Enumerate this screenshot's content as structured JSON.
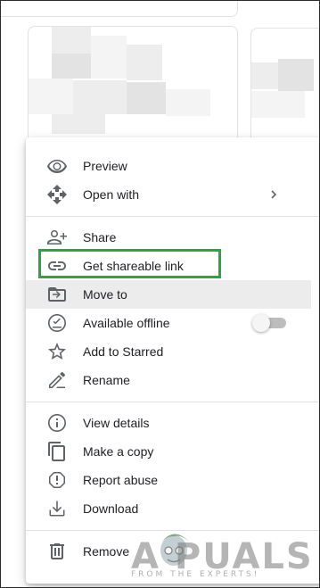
{
  "menu": {
    "groups": [
      [
        {
          "label": "Preview",
          "icon": "eye-icon"
        },
        {
          "label": "Open with",
          "icon": "move-arrows-icon",
          "submenu": true
        }
      ],
      [
        {
          "label": "Share",
          "icon": "person-add-icon"
        },
        {
          "label": "Get shareable link",
          "icon": "link-icon",
          "outlined": true
        },
        {
          "label": "Move to",
          "icon": "folder-move-icon",
          "hovered": true
        },
        {
          "label": "Available offline",
          "icon": "offline-check-icon",
          "toggle": false
        },
        {
          "label": "Add to Starred",
          "icon": "star-outline-icon"
        },
        {
          "label": "Rename",
          "icon": "pencil-icon"
        }
      ],
      [
        {
          "label": "View details",
          "icon": "info-icon"
        },
        {
          "label": "Make a copy",
          "icon": "copy-icon"
        },
        {
          "label": "Report abuse",
          "icon": "report-icon"
        },
        {
          "label": "Download",
          "icon": "download-icon"
        }
      ],
      [
        {
          "label": "Remove",
          "icon": "trash-icon"
        }
      ]
    ]
  },
  "annotation": {
    "color": "#2aa640"
  },
  "watermark": {
    "text": "A PUALS",
    "sub": "FROM THE EXPERTS!"
  },
  "colors": {
    "text": "#202124",
    "icon": "#5f6368",
    "hover": "#ececec",
    "divider": "#e0e0e0"
  }
}
